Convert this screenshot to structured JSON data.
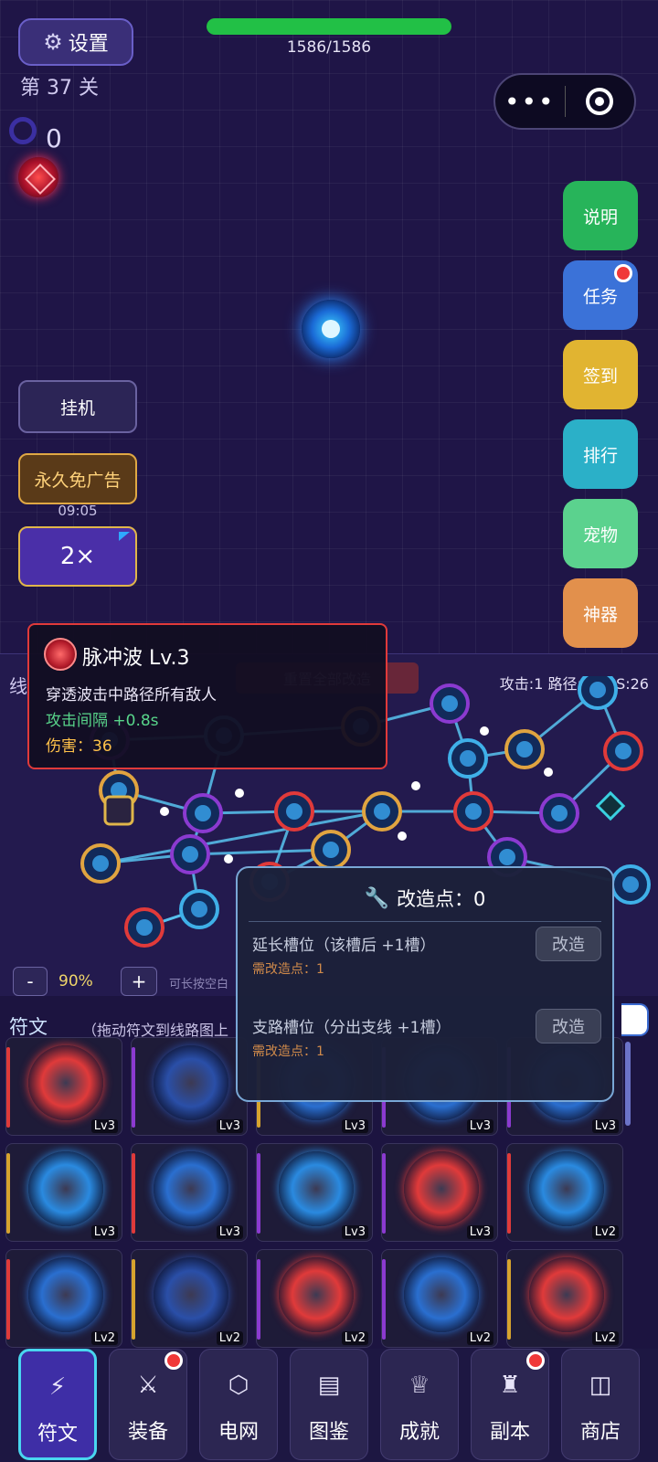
{
  "header": {
    "settings_label": "设置",
    "level_label": "第 37 关",
    "ring_count": "0",
    "hp_text": "1586/1586",
    "hp_fraction": 1.0
  },
  "side_menu": [
    {
      "label": "说明",
      "color": "#27b45a",
      "badge": false
    },
    {
      "label": "任务",
      "color": "#3b72d8",
      "badge": true
    },
    {
      "label": "签到",
      "color": "#e1b431",
      "badge": false
    },
    {
      "label": "排行",
      "color": "#2bb0c8",
      "badge": false
    },
    {
      "label": "宠物",
      "color": "#5bd28e",
      "badge": false
    },
    {
      "label": "神器",
      "color": "#e2904c",
      "badge": false
    }
  ],
  "left_controls": {
    "idle_label": "挂机",
    "no_ads_label": "永久免广告",
    "timer": "09:05",
    "speed_label": "2×"
  },
  "circuit": {
    "title": "线",
    "reset_label": "重置全部改造",
    "stats": "攻击:1 路径:1 DPS:26",
    "zoom_out": "-",
    "zoom_pct": "90%",
    "zoom_in": "+",
    "hint": "可长按空白"
  },
  "tooltip": {
    "title": "脉冲波 Lv.3",
    "description": "穿透波击中路径所有敌人",
    "interval": "攻击间隔 +0.8s",
    "damage": "伤害：36"
  },
  "rune_section": {
    "title": "符文",
    "hint": "（拖动符文到线路图上",
    "cells": [
      {
        "level": "Lv3",
        "stripe": "#e03a3a",
        "art": "#e03a3a"
      },
      {
        "level": "Lv3",
        "stripe": "#8b3ad0",
        "art": "#2a4fa8"
      },
      {
        "level": "Lv3",
        "stripe": "#d6a32e",
        "art": "#2a6fd0"
      },
      {
        "level": "Lv3",
        "stripe": "#8b3ad0",
        "art": "#2a6fd0"
      },
      {
        "level": "Lv3",
        "stripe": "#8b3ad0",
        "art": "#2a6fd0"
      },
      {
        "level": "Lv3",
        "stripe": "#d6a32e",
        "art": "#2a8ae0"
      },
      {
        "level": "Lv3",
        "stripe": "#e03a3a",
        "art": "#2a6fd0"
      },
      {
        "level": "Lv3",
        "stripe": "#8b3ad0",
        "art": "#2a8ae0"
      },
      {
        "level": "Lv3",
        "stripe": "#8b3ad0",
        "art": "#e03a3a"
      },
      {
        "level": "Lv2",
        "stripe": "#e03a3a",
        "art": "#2a8ae0"
      },
      {
        "level": "Lv2",
        "stripe": "#e03a3a",
        "art": "#2a6fd0"
      },
      {
        "level": "Lv2",
        "stripe": "#d6a32e",
        "art": "#2a4fa8"
      },
      {
        "level": "Lv2",
        "stripe": "#8b3ad0",
        "art": "#e03a3a"
      },
      {
        "level": "Lv2",
        "stripe": "#8b3ad0",
        "art": "#2a6fd0"
      },
      {
        "level": "Lv2",
        "stripe": "#d6a32e",
        "art": "#e03a3a"
      }
    ]
  },
  "modify_modal": {
    "title": "改造点：0",
    "options": [
      {
        "label": "延长槽位（该槽后 +1槽）",
        "cost": "需改造点：1",
        "button": "改造"
      },
      {
        "label": "支路槽位（分出支线 +1槽）",
        "cost": "需改造点：1",
        "button": "改造"
      }
    ]
  },
  "bottom_nav": [
    {
      "label": "符文",
      "icon": "lightning-icon",
      "glyph": "⚡",
      "active": true,
      "badge": false
    },
    {
      "label": "装备",
      "icon": "sword-icon",
      "glyph": "⚔",
      "active": false,
      "badge": true
    },
    {
      "label": "电网",
      "icon": "hexagon-icon",
      "glyph": "⬡",
      "active": false,
      "badge": false
    },
    {
      "label": "图鉴",
      "icon": "book-icon",
      "glyph": "▤",
      "active": false,
      "badge": false
    },
    {
      "label": "成就",
      "icon": "trophy-icon",
      "glyph": "♕",
      "active": false,
      "badge": false
    },
    {
      "label": "副本",
      "icon": "castle-icon",
      "glyph": "♜",
      "active": false,
      "badge": true
    },
    {
      "label": "商店",
      "icon": "shop-bag-icon",
      "glyph": "◫",
      "active": false,
      "badge": false
    }
  ]
}
